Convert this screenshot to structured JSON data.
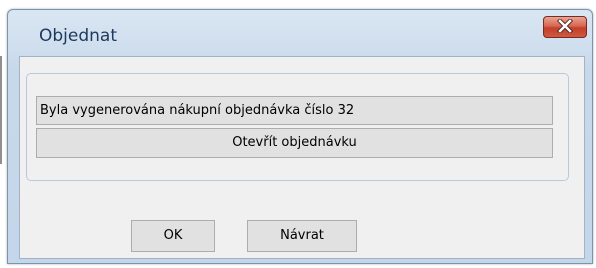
{
  "window": {
    "title": "Objednat"
  },
  "dialog": {
    "message": "Byla vygenerována nákupní objednávka číslo 32",
    "open_order_label": "Otevřít objednávku"
  },
  "buttons": {
    "ok_label": "OK",
    "back_label": "Návrat"
  },
  "icons": {
    "close": "close-icon"
  },
  "colors": {
    "title_text": "#1e395b",
    "close_button": "#c3402b",
    "frame": "#c4d6e9",
    "client_bg": "#f0f0f0",
    "button_bg": "#e1e1e1"
  }
}
